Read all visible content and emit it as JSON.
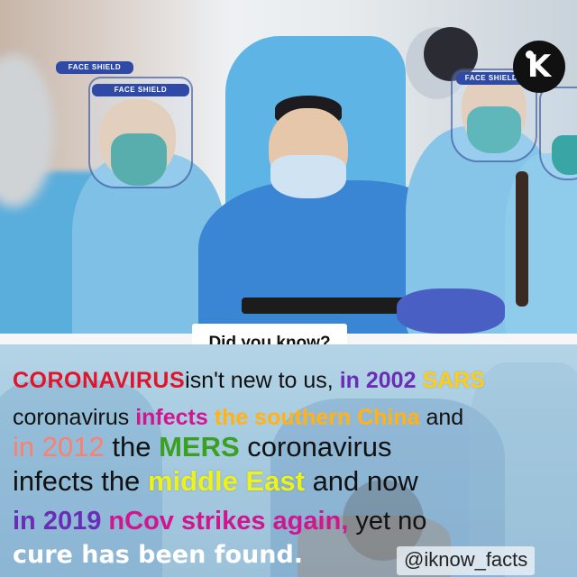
{
  "photo": {
    "shield_label": "FACE SHIELD",
    "logo_letter": "K"
  },
  "caption": "Did you know?",
  "text": {
    "l1": {
      "a": "CORONAVIRUS",
      "b": "isn't new to us,",
      "c": "in 2002",
      "d": "SARS"
    },
    "l2": {
      "a": "coronavirus",
      "b": "infects",
      "c": "the southern China",
      "d": "and"
    },
    "l3": {
      "a": "in 2012",
      "b": "the",
      "c": "MERS",
      "d": "coronavirus"
    },
    "l4": {
      "a": "infects the",
      "b": "middle East",
      "c": "and now"
    },
    "l5": {
      "a": "in 2019",
      "b": "nCov",
      "c": "strikes again,",
      "d": "yet no"
    },
    "l6": {
      "a": "cure has been found."
    }
  },
  "handle": "@iknow_facts",
  "colors": {
    "coronavirus_red": "#e0142b",
    "purple": "#6a2db8",
    "yellow": "#ffcc1a",
    "magenta": "#d0168f",
    "green": "#3aa020",
    "lime": "#ecf21a"
  }
}
